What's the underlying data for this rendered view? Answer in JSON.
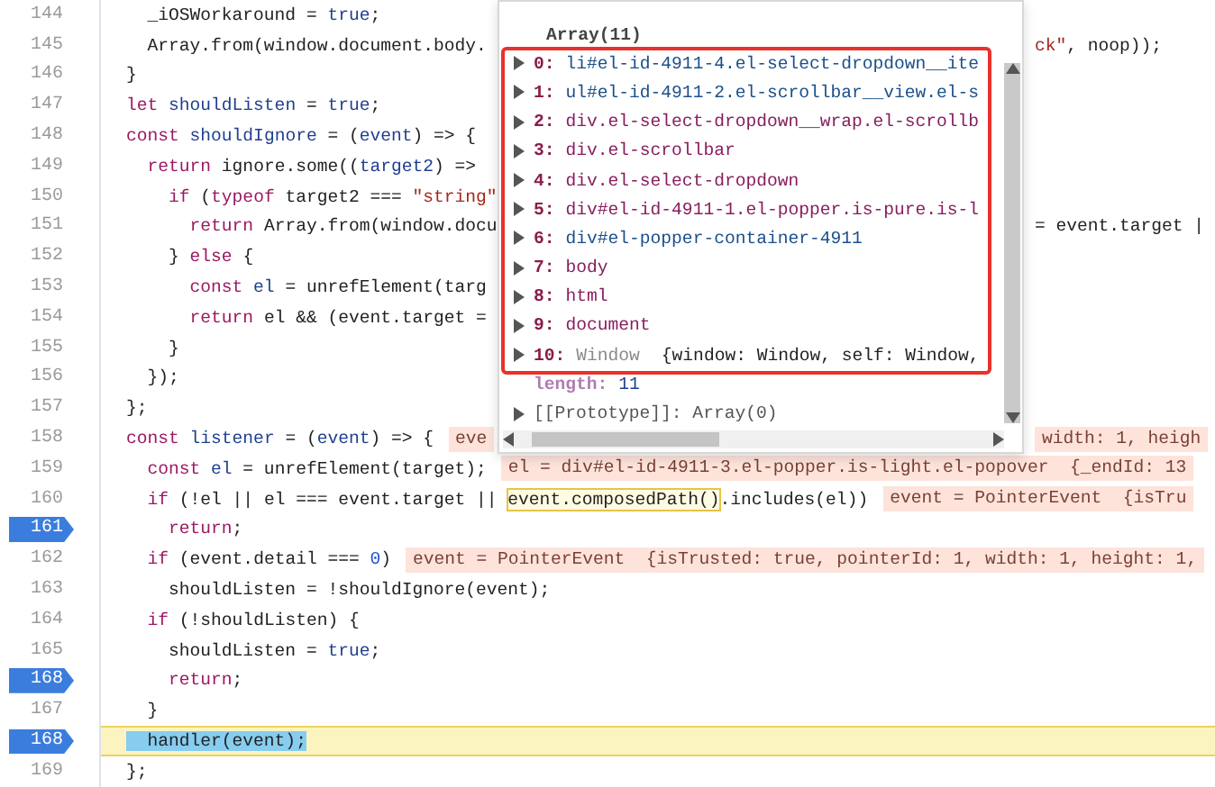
{
  "lines": [
    {
      "number": "144",
      "breakpoint": false,
      "current": false,
      "code": [
        {
          "text": "  _iOSWorkaround = ",
          "kind": "plain"
        },
        {
          "text": "true",
          "kind": "var"
        },
        {
          "text": ";",
          "kind": "plain"
        }
      ]
    },
    {
      "number": "145",
      "breakpoint": false,
      "current": false,
      "code": [
        {
          "text": "  Array.from(window.document.body.",
          "kind": "plain"
        }
      ],
      "tail": [
        {
          "text": "ck\"",
          "kind": "str"
        },
        {
          "text": ", noop));",
          "kind": "plain"
        }
      ]
    },
    {
      "number": "146",
      "breakpoint": false,
      "current": false,
      "code": [
        {
          "text": "}",
          "kind": "plain"
        }
      ]
    },
    {
      "number": "147",
      "breakpoint": false,
      "current": false,
      "code": [
        {
          "text": "let",
          "kind": "kw"
        },
        {
          "text": " shouldListen",
          "kind": "var"
        },
        {
          "text": " = ",
          "kind": "plain"
        },
        {
          "text": "true",
          "kind": "var"
        },
        {
          "text": ";",
          "kind": "plain"
        }
      ]
    },
    {
      "number": "148",
      "breakpoint": false,
      "current": false,
      "code": [
        {
          "text": "const",
          "kind": "kw"
        },
        {
          "text": " shouldIgnore",
          "kind": "var"
        },
        {
          "text": " = (",
          "kind": "plain"
        },
        {
          "text": "event",
          "kind": "var"
        },
        {
          "text": ") => {",
          "kind": "plain"
        }
      ]
    },
    {
      "number": "149",
      "breakpoint": false,
      "current": false,
      "code": [
        {
          "text": "  return",
          "kind": "kw"
        },
        {
          "text": " ignore.some((",
          "kind": "plain"
        },
        {
          "text": "target2",
          "kind": "var"
        },
        {
          "text": ") =>",
          "kind": "plain"
        }
      ]
    },
    {
      "number": "150",
      "breakpoint": false,
      "current": false,
      "code": [
        {
          "text": "    if",
          "kind": "kw"
        },
        {
          "text": " (",
          "kind": "plain"
        },
        {
          "text": "typeof",
          "kind": "kw"
        },
        {
          "text": " target2 === ",
          "kind": "plain"
        },
        {
          "text": "\"string\"",
          "kind": "str"
        }
      ]
    },
    {
      "number": "151",
      "breakpoint": false,
      "current": false,
      "code": [
        {
          "text": "      return",
          "kind": "kw"
        },
        {
          "text": " Array.from(window.docu",
          "kind": "plain"
        }
      ],
      "tail": [
        {
          "text": "= event.target |",
          "kind": "plain"
        }
      ]
    },
    {
      "number": "152",
      "breakpoint": false,
      "current": false,
      "code": [
        {
          "text": "    } ",
          "kind": "plain"
        },
        {
          "text": "else",
          "kind": "kw"
        },
        {
          "text": " {",
          "kind": "plain"
        }
      ]
    },
    {
      "number": "153",
      "breakpoint": false,
      "current": false,
      "code": [
        {
          "text": "      const",
          "kind": "kw"
        },
        {
          "text": " el",
          "kind": "var"
        },
        {
          "text": " = unrefElement(targ",
          "kind": "plain"
        }
      ]
    },
    {
      "number": "154",
      "breakpoint": false,
      "current": false,
      "code": [
        {
          "text": "      return",
          "kind": "kw"
        },
        {
          "text": " el && (event.target =",
          "kind": "plain"
        }
      ]
    },
    {
      "number": "155",
      "breakpoint": false,
      "current": false,
      "code": [
        {
          "text": "    }",
          "kind": "plain"
        }
      ]
    },
    {
      "number": "156",
      "breakpoint": false,
      "current": false,
      "code": [
        {
          "text": "  });",
          "kind": "plain"
        }
      ]
    },
    {
      "number": "157",
      "breakpoint": false,
      "current": false,
      "code": [
        {
          "text": "};",
          "kind": "plain"
        }
      ]
    },
    {
      "number": "158",
      "breakpoint": false,
      "current": false,
      "code": [
        {
          "text": "const",
          "kind": "kw"
        },
        {
          "text": " listener",
          "kind": "var"
        },
        {
          "text": " = (",
          "kind": "plain"
        },
        {
          "text": "event",
          "kind": "var"
        },
        {
          "text": ") => {",
          "kind": "plain"
        },
        {
          "text": "eve",
          "kind": "inline"
        }
      ],
      "tail": [
        {
          "text": "width: 1, heigh",
          "kind": "inline"
        }
      ]
    },
    {
      "number": "159",
      "breakpoint": false,
      "current": false,
      "code": [
        {
          "text": "  const",
          "kind": "kw"
        },
        {
          "text": " el",
          "kind": "var"
        },
        {
          "text": " = unrefElement(target);",
          "kind": "plain"
        },
        {
          "text": "el = div#el-id-4911-3.el-popper.is-light.el-popover  {_endId: 13",
          "kind": "inline"
        }
      ]
    },
    {
      "number": "160",
      "breakpoint": false,
      "current": false,
      "code": [
        {
          "text": "  if",
          "kind": "kw"
        },
        {
          "text": " (!el || el === event.target || ",
          "kind": "plain"
        },
        {
          "text": "event.composedPath()",
          "kind": "match"
        },
        {
          "text": ".includes(el))",
          "kind": "plain"
        },
        {
          "text": "event = PointerEvent  {isTru",
          "kind": "inline"
        }
      ]
    },
    {
      "number": "161",
      "breakpoint": true,
      "current": false,
      "code": [
        {
          "text": "    return",
          "kind": "kw"
        },
        {
          "text": ";",
          "kind": "plain"
        }
      ]
    },
    {
      "number": "162",
      "breakpoint": false,
      "current": false,
      "code": [
        {
          "text": "  if",
          "kind": "kw"
        },
        {
          "text": " (event.detail === ",
          "kind": "plain"
        },
        {
          "text": "0",
          "kind": "num"
        },
        {
          "text": ")",
          "kind": "plain"
        },
        {
          "text": "event = PointerEvent  {isTrusted: true, pointerId: 1, width: 1, height: 1,",
          "kind": "inline"
        }
      ]
    },
    {
      "number": "163",
      "breakpoint": false,
      "current": false,
      "code": [
        {
          "text": "    shouldListen = !shouldIgnore(event);",
          "kind": "plain"
        }
      ]
    },
    {
      "number": "164",
      "breakpoint": false,
      "current": false,
      "code": [
        {
          "text": "  if",
          "kind": "kw"
        },
        {
          "text": " (!shouldListen) {",
          "kind": "plain"
        }
      ]
    },
    {
      "number": "165",
      "breakpoint": false,
      "current": false,
      "code": [
        {
          "text": "    shouldListen = ",
          "kind": "plain"
        },
        {
          "text": "true",
          "kind": "var"
        },
        {
          "text": ";",
          "kind": "plain"
        }
      ]
    },
    {
      "number": "168",
      "breakpoint": true,
      "current": false,
      "code": [
        {
          "text": "    return",
          "kind": "kw"
        },
        {
          "text": ";",
          "kind": "plain"
        }
      ]
    },
    {
      "number": "167",
      "breakpoint": false,
      "current": false,
      "code": [
        {
          "text": "  }",
          "kind": "plain"
        }
      ]
    },
    {
      "number": "168",
      "breakpoint": true,
      "current": true,
      "code": [
        {
          "text": "  handler(event);",
          "kind": "sel"
        }
      ]
    },
    {
      "number": "169",
      "breakpoint": false,
      "current": false,
      "code": [
        {
          "text": "};",
          "kind": "plain"
        }
      ]
    }
  ],
  "popup": {
    "title": "Array(11)",
    "entries": [
      {
        "index": "0:",
        "value": "li#el-id-4911-4.el-select-dropdown__ite",
        "color": "#1a4f8a"
      },
      {
        "index": "1:",
        "value": "ul#el-id-4911-2.el-scrollbar__view.el-s",
        "color": "#1a4f8a"
      },
      {
        "index": "2:",
        "value": "div.el-select-dropdown__wrap.el-scrollb",
        "color": "#881d5e"
      },
      {
        "index": "3:",
        "value": "div.el-scrollbar",
        "color": "#881d5e"
      },
      {
        "index": "4:",
        "value": "div.el-select-dropdown",
        "color": "#881d5e"
      },
      {
        "index": "5:",
        "value": "div#el-id-4911-1.el-popper.is-pure.is-l",
        "color": "#881d5e"
      },
      {
        "index": "6:",
        "value": "div#el-popper-container-4911",
        "color": "#1a4f8a"
      },
      {
        "index": "7:",
        "value": "body",
        "color": "#881d5e"
      },
      {
        "index": "8:",
        "value": "html",
        "color": "#881d5e"
      },
      {
        "index": "9:",
        "value": "document",
        "color": "#881d5e"
      },
      {
        "index": "10:",
        "value": "Window",
        "color": "#8a8a8a",
        "preview": "{window: Window, self: Window,"
      }
    ],
    "length_key": "length:",
    "length_value": "11",
    "prototype": "[[Prototype]]: Array(0)"
  }
}
